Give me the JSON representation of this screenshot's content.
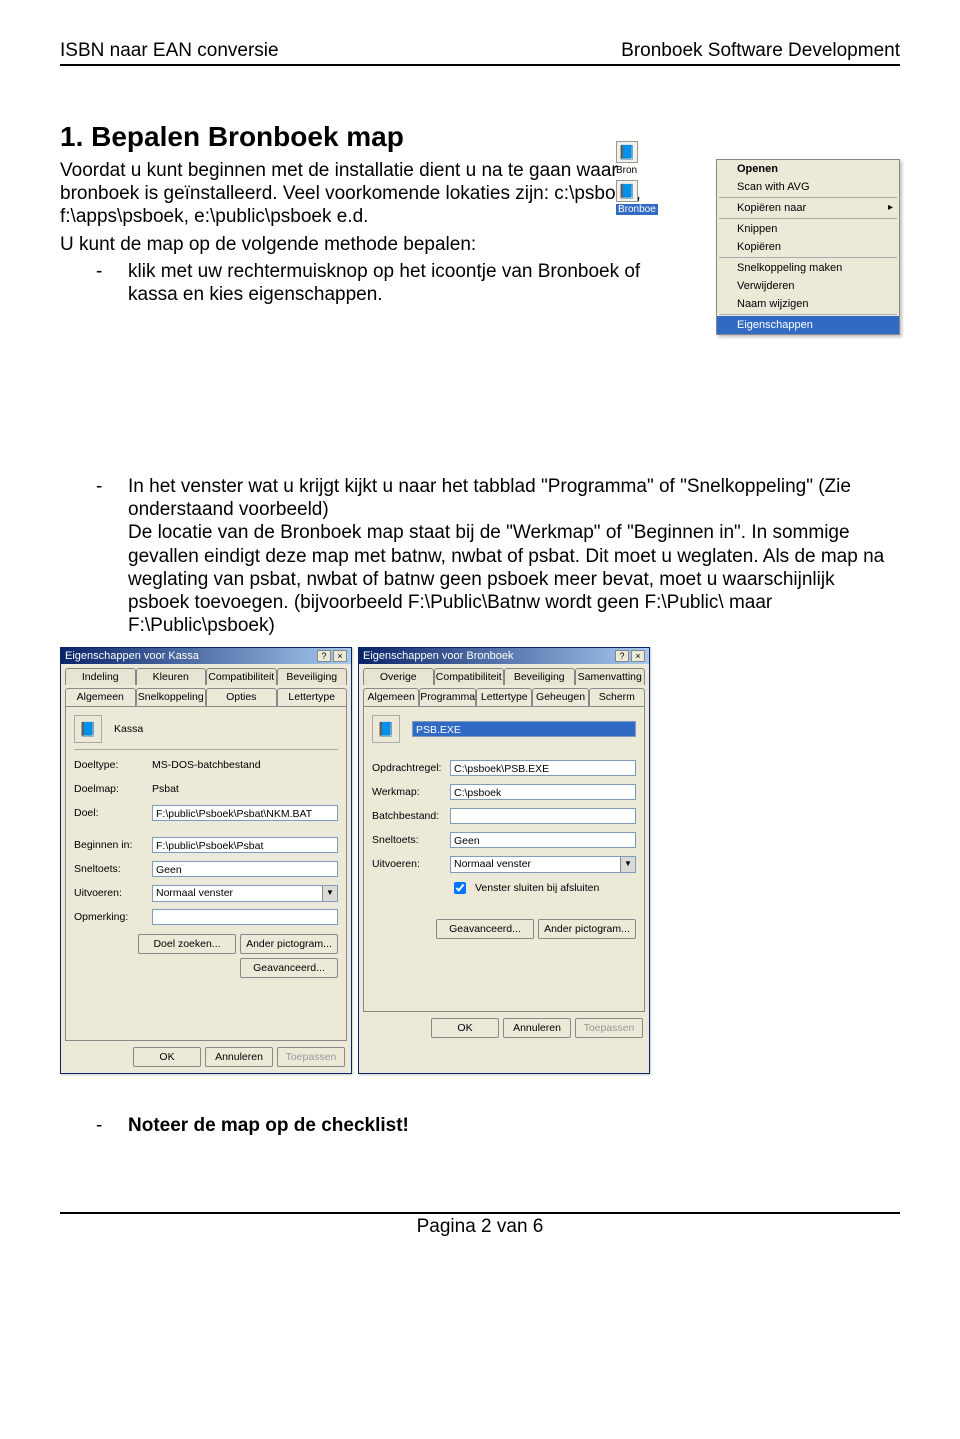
{
  "header": {
    "left": "ISBN naar EAN conversie",
    "right": "Bronboek Software Development"
  },
  "title": "1. Bepalen Bronboek map",
  "p1": "Voordat u kunt beginnen met de installatie dient u na te gaan waar bronboek is geïnstalleerd. Veel voorkomende lokaties zijn: c:\\psboek, f:\\apps\\psboek, e:\\public\\psboek e.d.",
  "p2_intro": "U kunt de map op de volgende methode bepalen:",
  "bullet1": "klik met uw rechtermuisknop op het icoontje van Bronboek of kassa en kies eigenschappen.",
  "context_icons": {
    "top": "Bron",
    "bottom": "Bronboe"
  },
  "ctxmenu": {
    "open": "Openen",
    "scan": "Scan with AVG",
    "copyto": "Kopiëren naar",
    "cut": "Knippen",
    "copy": "Kopiëren",
    "shortcut": "Snelkoppeling maken",
    "delete": "Verwijderen",
    "rename": "Naam wijzigen",
    "props": "Eigenschappen"
  },
  "bullet2": "In het venster wat u krijgt kijkt u naar het tabblad \"Programma\" of \"Snelkoppeling\" (Zie onderstaand voorbeeld)\nDe locatie van de Bronboek map staat bij de \"Werkmap\" of \"Beginnen in\". In sommige gevallen eindigt deze map met batnw, nwbat of psbat. Dit moet u weglaten. Als de map na weglating van psbat, nwbat of batnw geen psboek meer bevat, moet u waarschijnlijk psboek toevoegen. (bijvoorbeeld F:\\Public\\Batnw wordt geen F:\\Public\\ maar F:\\Public\\psboek)",
  "dlg_kassa": {
    "title": "Eigenschappen voor Kassa",
    "tabs_back": [
      "Indeling",
      "Kleuren",
      "Compatibiliteit",
      "Beveiliging"
    ],
    "tabs_front": [
      "Algemeen",
      "Snelkoppeling",
      "Opties",
      "Lettertype"
    ],
    "name": "Kassa",
    "fields": {
      "doeltype_l": "Doeltype:",
      "doeltype_v": "MS-DOS-batchbestand",
      "doelmap_l": "Doelmap:",
      "doelmap_v": "Psbat",
      "doel_l": "Doel:",
      "doel_v": "F:\\public\\Psboek\\Psbat\\NKM.BAT",
      "beginnen_l": "Beginnen in:",
      "beginnen_v": "F:\\public\\Psboek\\Psbat",
      "sneltoets_l": "Sneltoets:",
      "sneltoets_v": "Geen",
      "uitvoeren_l": "Uitvoeren:",
      "uitvoeren_v": "Normaal venster",
      "opmerking_l": "Opmerking:",
      "opmerking_v": ""
    },
    "buttons": {
      "doel_zoeken": "Doel zoeken...",
      "ander_pict": "Ander pictogram...",
      "geavanceerd": "Geavanceerd..."
    }
  },
  "dlg_bronboek": {
    "title": "Eigenschappen voor Bronboek",
    "tabs_back": [
      "Overige",
      "Compatibiliteit",
      "Beveiliging",
      "Samenvatting"
    ],
    "tabs_front": [
      "Algemeen",
      "Programma",
      "Lettertype",
      "Geheugen",
      "Scherm"
    ],
    "name": "PSB.EXE",
    "fields": {
      "opdracht_l": "Opdrachtregel:",
      "opdracht_v": "C:\\psboek\\PSB.EXE",
      "werkmap_l": "Werkmap:",
      "werkmap_v": "C:\\psboek",
      "batch_l": "Batchbestand:",
      "batch_v": "",
      "sneltoets_l": "Sneltoets:",
      "sneltoets_v": "Geen",
      "uitvoeren_l": "Uitvoeren:",
      "uitvoeren_v": "Normaal venster",
      "chk": "Venster sluiten bij afsluiten"
    },
    "buttons": {
      "geavanceerd": "Geavanceerd...",
      "ander_pict": "Ander pictogram..."
    }
  },
  "common_buttons": {
    "ok": "OK",
    "annuleren": "Annuleren",
    "toepassen": "Toepassen"
  },
  "bullet3": "Noteer de map op de checklist!",
  "footer": "Pagina 2 van 6"
}
